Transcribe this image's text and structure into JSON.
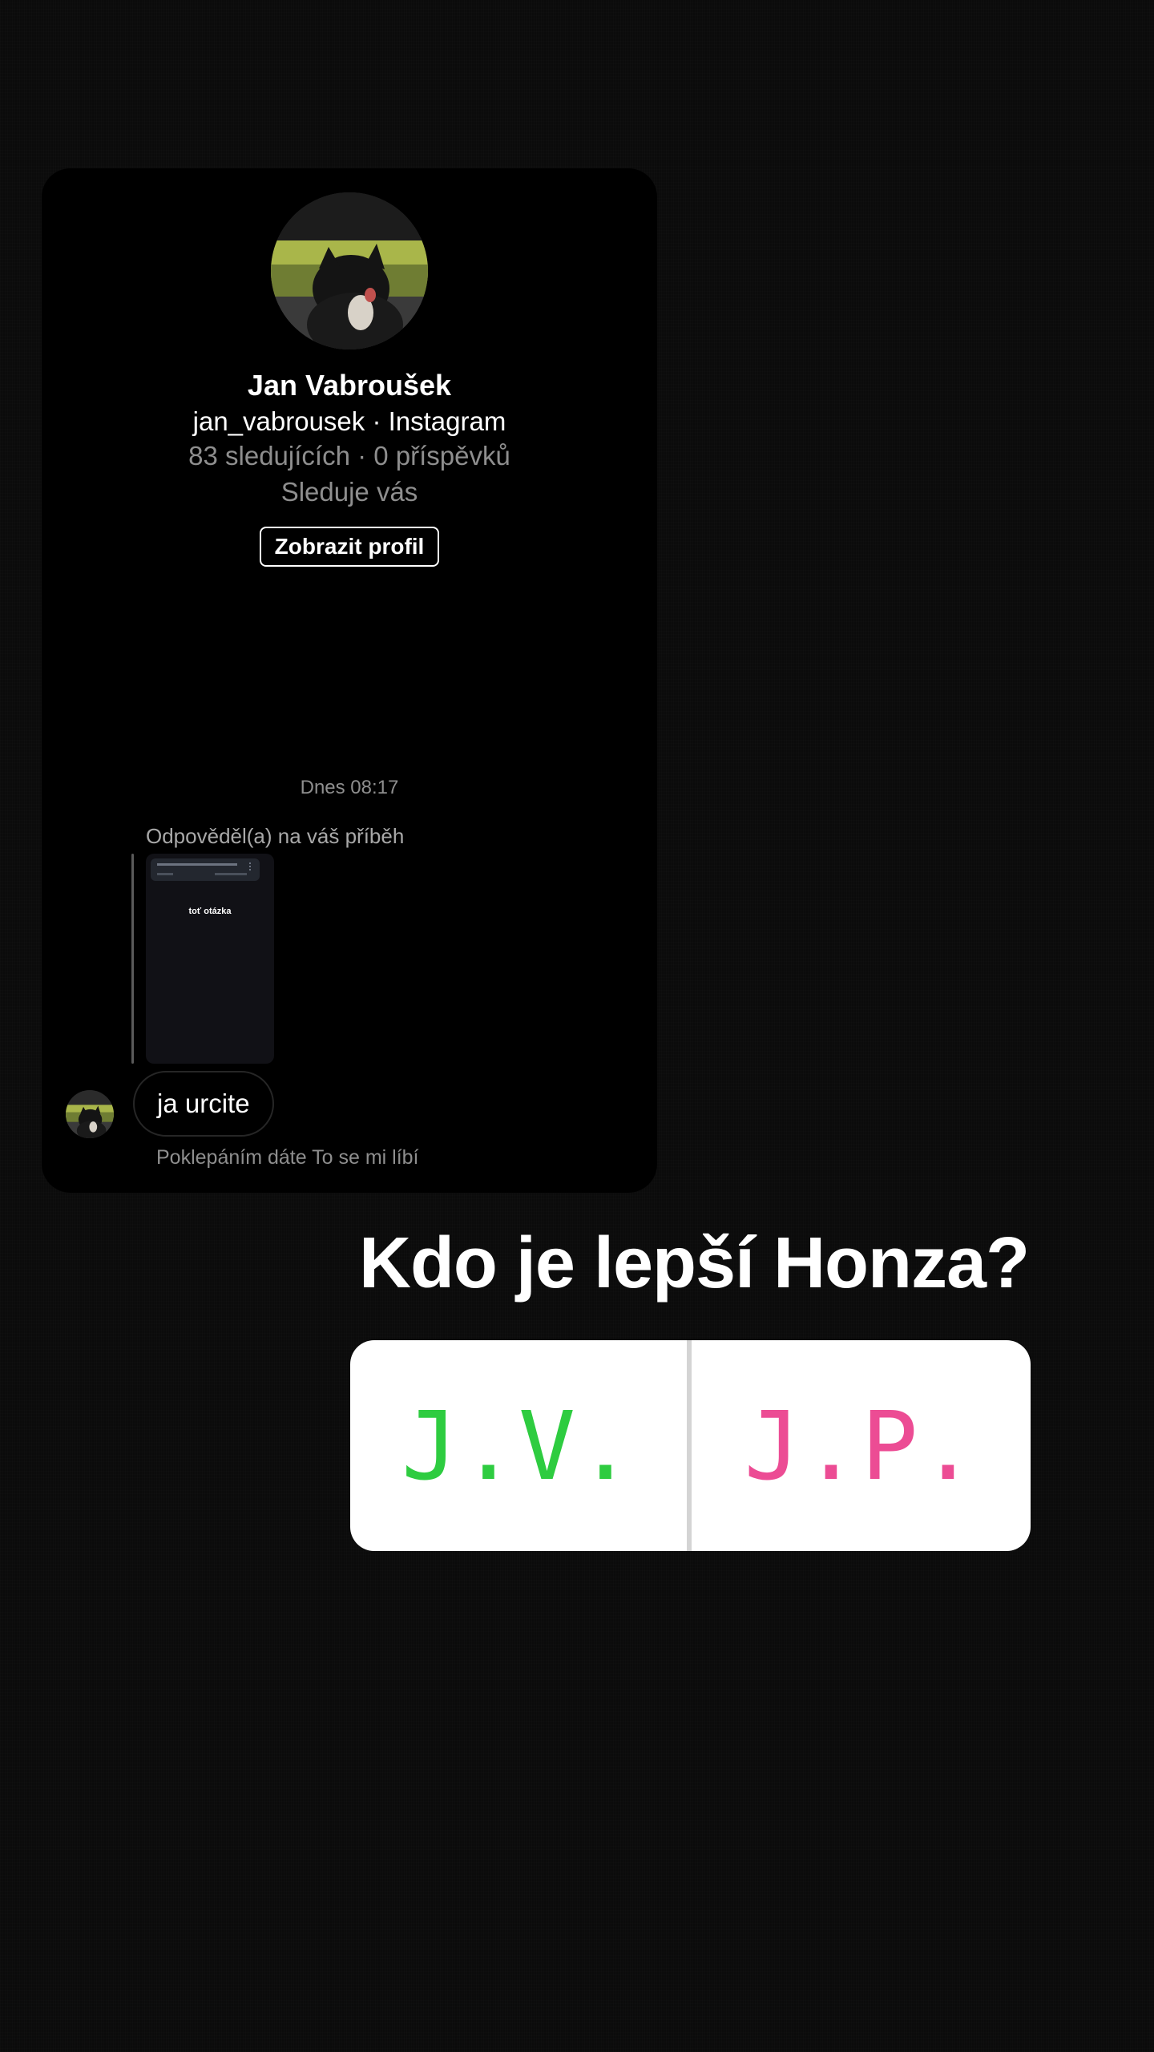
{
  "profile": {
    "name": "Jan Vabroušek",
    "handle": "jan_vabrousek · Instagram",
    "stats": "83 sledujících · 0 příspěvků",
    "follows": "Sleduje vás",
    "view_profile_label": "Zobrazit profil"
  },
  "chat": {
    "timestamp": "Dnes 08:17",
    "replied_label": "Odpověděl(a) na váš příběh",
    "story_thumb_text": "toť otázka",
    "message": "ja urcite",
    "like_hint": "Poklepáním dáte To se mi líbí"
  },
  "story": {
    "question": "Kdo je lepší Honza?",
    "options": [
      {
        "label": "J.V.",
        "color": "#2ecc40"
      },
      {
        "label": "J.P.",
        "color": "#ec4c94"
      }
    ]
  },
  "icons": [
    "dog-avatar-icon"
  ]
}
